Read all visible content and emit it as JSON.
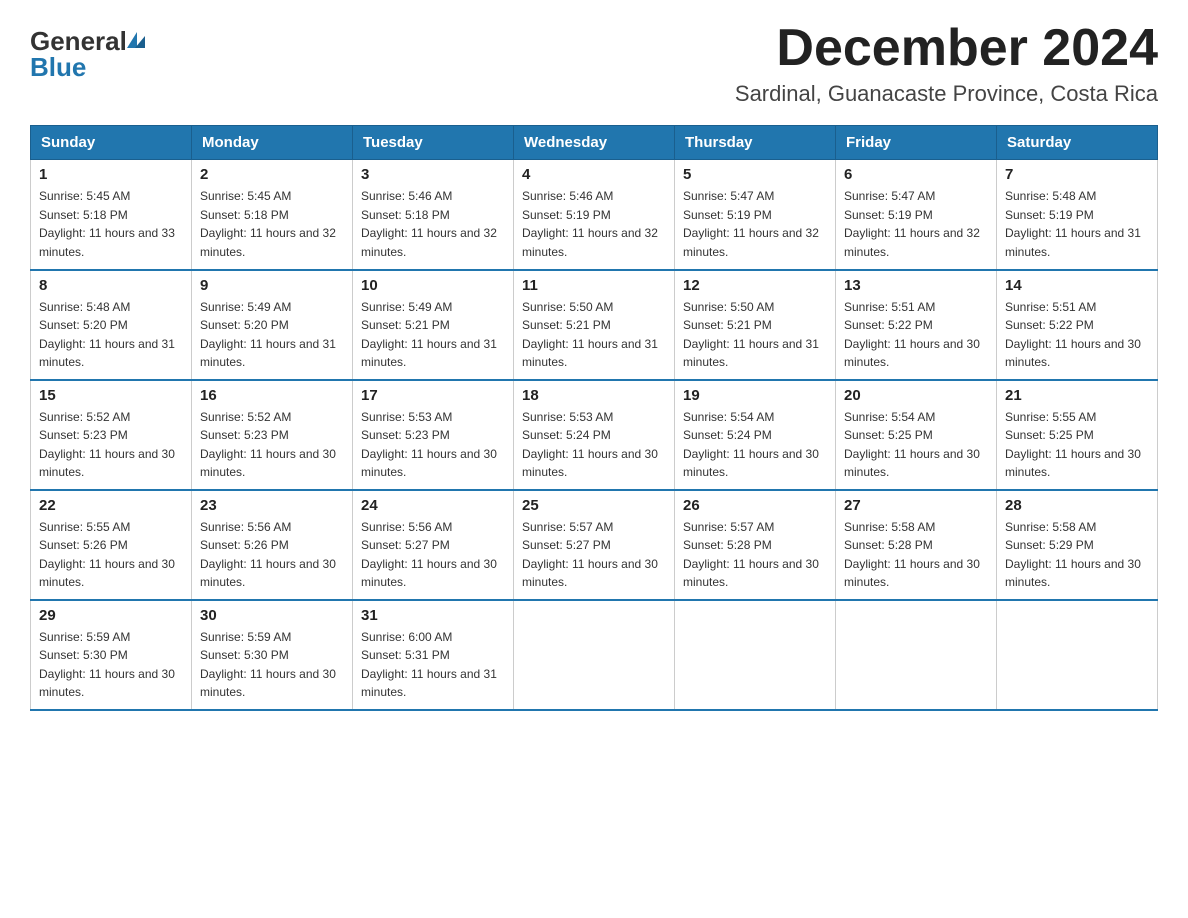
{
  "header": {
    "logo_general": "General",
    "logo_blue": "Blue",
    "month_title": "December 2024",
    "location": "Sardinal, Guanacaste Province, Costa Rica"
  },
  "calendar": {
    "days_of_week": [
      "Sunday",
      "Monday",
      "Tuesday",
      "Wednesday",
      "Thursday",
      "Friday",
      "Saturday"
    ],
    "weeks": [
      [
        {
          "day": "1",
          "sunrise": "Sunrise: 5:45 AM",
          "sunset": "Sunset: 5:18 PM",
          "daylight": "Daylight: 11 hours and 33 minutes."
        },
        {
          "day": "2",
          "sunrise": "Sunrise: 5:45 AM",
          "sunset": "Sunset: 5:18 PM",
          "daylight": "Daylight: 11 hours and 32 minutes."
        },
        {
          "day": "3",
          "sunrise": "Sunrise: 5:46 AM",
          "sunset": "Sunset: 5:18 PM",
          "daylight": "Daylight: 11 hours and 32 minutes."
        },
        {
          "day": "4",
          "sunrise": "Sunrise: 5:46 AM",
          "sunset": "Sunset: 5:19 PM",
          "daylight": "Daylight: 11 hours and 32 minutes."
        },
        {
          "day": "5",
          "sunrise": "Sunrise: 5:47 AM",
          "sunset": "Sunset: 5:19 PM",
          "daylight": "Daylight: 11 hours and 32 minutes."
        },
        {
          "day": "6",
          "sunrise": "Sunrise: 5:47 AM",
          "sunset": "Sunset: 5:19 PM",
          "daylight": "Daylight: 11 hours and 32 minutes."
        },
        {
          "day": "7",
          "sunrise": "Sunrise: 5:48 AM",
          "sunset": "Sunset: 5:19 PM",
          "daylight": "Daylight: 11 hours and 31 minutes."
        }
      ],
      [
        {
          "day": "8",
          "sunrise": "Sunrise: 5:48 AM",
          "sunset": "Sunset: 5:20 PM",
          "daylight": "Daylight: 11 hours and 31 minutes."
        },
        {
          "day": "9",
          "sunrise": "Sunrise: 5:49 AM",
          "sunset": "Sunset: 5:20 PM",
          "daylight": "Daylight: 11 hours and 31 minutes."
        },
        {
          "day": "10",
          "sunrise": "Sunrise: 5:49 AM",
          "sunset": "Sunset: 5:21 PM",
          "daylight": "Daylight: 11 hours and 31 minutes."
        },
        {
          "day": "11",
          "sunrise": "Sunrise: 5:50 AM",
          "sunset": "Sunset: 5:21 PM",
          "daylight": "Daylight: 11 hours and 31 minutes."
        },
        {
          "day": "12",
          "sunrise": "Sunrise: 5:50 AM",
          "sunset": "Sunset: 5:21 PM",
          "daylight": "Daylight: 11 hours and 31 minutes."
        },
        {
          "day": "13",
          "sunrise": "Sunrise: 5:51 AM",
          "sunset": "Sunset: 5:22 PM",
          "daylight": "Daylight: 11 hours and 30 minutes."
        },
        {
          "day": "14",
          "sunrise": "Sunrise: 5:51 AM",
          "sunset": "Sunset: 5:22 PM",
          "daylight": "Daylight: 11 hours and 30 minutes."
        }
      ],
      [
        {
          "day": "15",
          "sunrise": "Sunrise: 5:52 AM",
          "sunset": "Sunset: 5:23 PM",
          "daylight": "Daylight: 11 hours and 30 minutes."
        },
        {
          "day": "16",
          "sunrise": "Sunrise: 5:52 AM",
          "sunset": "Sunset: 5:23 PM",
          "daylight": "Daylight: 11 hours and 30 minutes."
        },
        {
          "day": "17",
          "sunrise": "Sunrise: 5:53 AM",
          "sunset": "Sunset: 5:23 PM",
          "daylight": "Daylight: 11 hours and 30 minutes."
        },
        {
          "day": "18",
          "sunrise": "Sunrise: 5:53 AM",
          "sunset": "Sunset: 5:24 PM",
          "daylight": "Daylight: 11 hours and 30 minutes."
        },
        {
          "day": "19",
          "sunrise": "Sunrise: 5:54 AM",
          "sunset": "Sunset: 5:24 PM",
          "daylight": "Daylight: 11 hours and 30 minutes."
        },
        {
          "day": "20",
          "sunrise": "Sunrise: 5:54 AM",
          "sunset": "Sunset: 5:25 PM",
          "daylight": "Daylight: 11 hours and 30 minutes."
        },
        {
          "day": "21",
          "sunrise": "Sunrise: 5:55 AM",
          "sunset": "Sunset: 5:25 PM",
          "daylight": "Daylight: 11 hours and 30 minutes."
        }
      ],
      [
        {
          "day": "22",
          "sunrise": "Sunrise: 5:55 AM",
          "sunset": "Sunset: 5:26 PM",
          "daylight": "Daylight: 11 hours and 30 minutes."
        },
        {
          "day": "23",
          "sunrise": "Sunrise: 5:56 AM",
          "sunset": "Sunset: 5:26 PM",
          "daylight": "Daylight: 11 hours and 30 minutes."
        },
        {
          "day": "24",
          "sunrise": "Sunrise: 5:56 AM",
          "sunset": "Sunset: 5:27 PM",
          "daylight": "Daylight: 11 hours and 30 minutes."
        },
        {
          "day": "25",
          "sunrise": "Sunrise: 5:57 AM",
          "sunset": "Sunset: 5:27 PM",
          "daylight": "Daylight: 11 hours and 30 minutes."
        },
        {
          "day": "26",
          "sunrise": "Sunrise: 5:57 AM",
          "sunset": "Sunset: 5:28 PM",
          "daylight": "Daylight: 11 hours and 30 minutes."
        },
        {
          "day": "27",
          "sunrise": "Sunrise: 5:58 AM",
          "sunset": "Sunset: 5:28 PM",
          "daylight": "Daylight: 11 hours and 30 minutes."
        },
        {
          "day": "28",
          "sunrise": "Sunrise: 5:58 AM",
          "sunset": "Sunset: 5:29 PM",
          "daylight": "Daylight: 11 hours and 30 minutes."
        }
      ],
      [
        {
          "day": "29",
          "sunrise": "Sunrise: 5:59 AM",
          "sunset": "Sunset: 5:30 PM",
          "daylight": "Daylight: 11 hours and 30 minutes."
        },
        {
          "day": "30",
          "sunrise": "Sunrise: 5:59 AM",
          "sunset": "Sunset: 5:30 PM",
          "daylight": "Daylight: 11 hours and 30 minutes."
        },
        {
          "day": "31",
          "sunrise": "Sunrise: 6:00 AM",
          "sunset": "Sunset: 5:31 PM",
          "daylight": "Daylight: 11 hours and 31 minutes."
        },
        null,
        null,
        null,
        null
      ]
    ]
  }
}
